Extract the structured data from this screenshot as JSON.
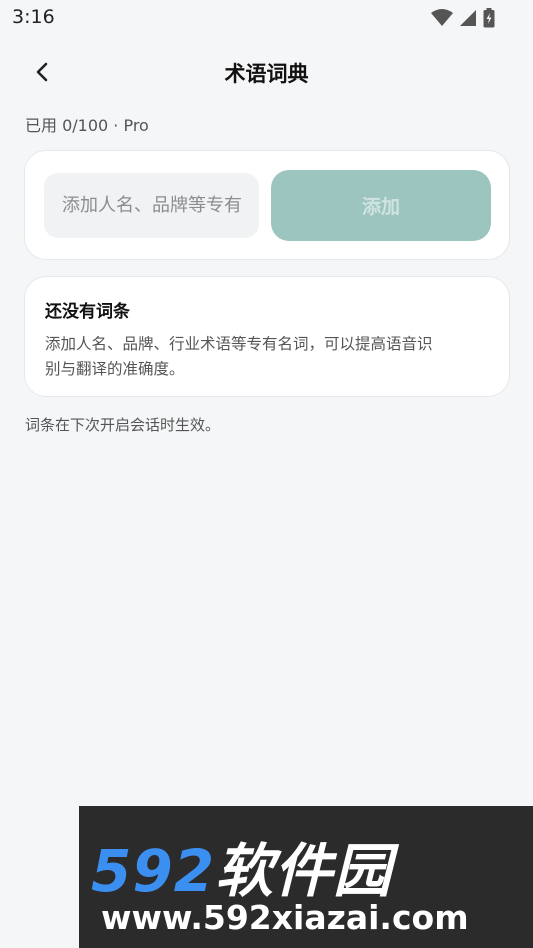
{
  "status": {
    "time": "3:16"
  },
  "header": {
    "title": "术语词典"
  },
  "usage": {
    "text": "已用 0/100 · Pro"
  },
  "input": {
    "placeholder": "添加人名、品牌等专有名词"
  },
  "add_button": {
    "label": "添加"
  },
  "empty_state": {
    "title": "还没有词条",
    "description_line1": "添加人名、品牌、行业术语等专有名词，可以提高语音识",
    "description_line2": "别与翻译的准确度。"
  },
  "note": {
    "text": "词条在下次开启会话时生效。"
  },
  "watermark": {
    "logo_num": "592",
    "logo_name": "软件园",
    "url": "www.592xiazai.com"
  },
  "colors": {
    "background": "#f5f6f8",
    "accent_disabled": "#9dc5c0",
    "card": "#ffffff"
  },
  "icons": [
    "back-arrow-icon",
    "wifi-icon",
    "signal-icon",
    "battery-icon"
  ]
}
